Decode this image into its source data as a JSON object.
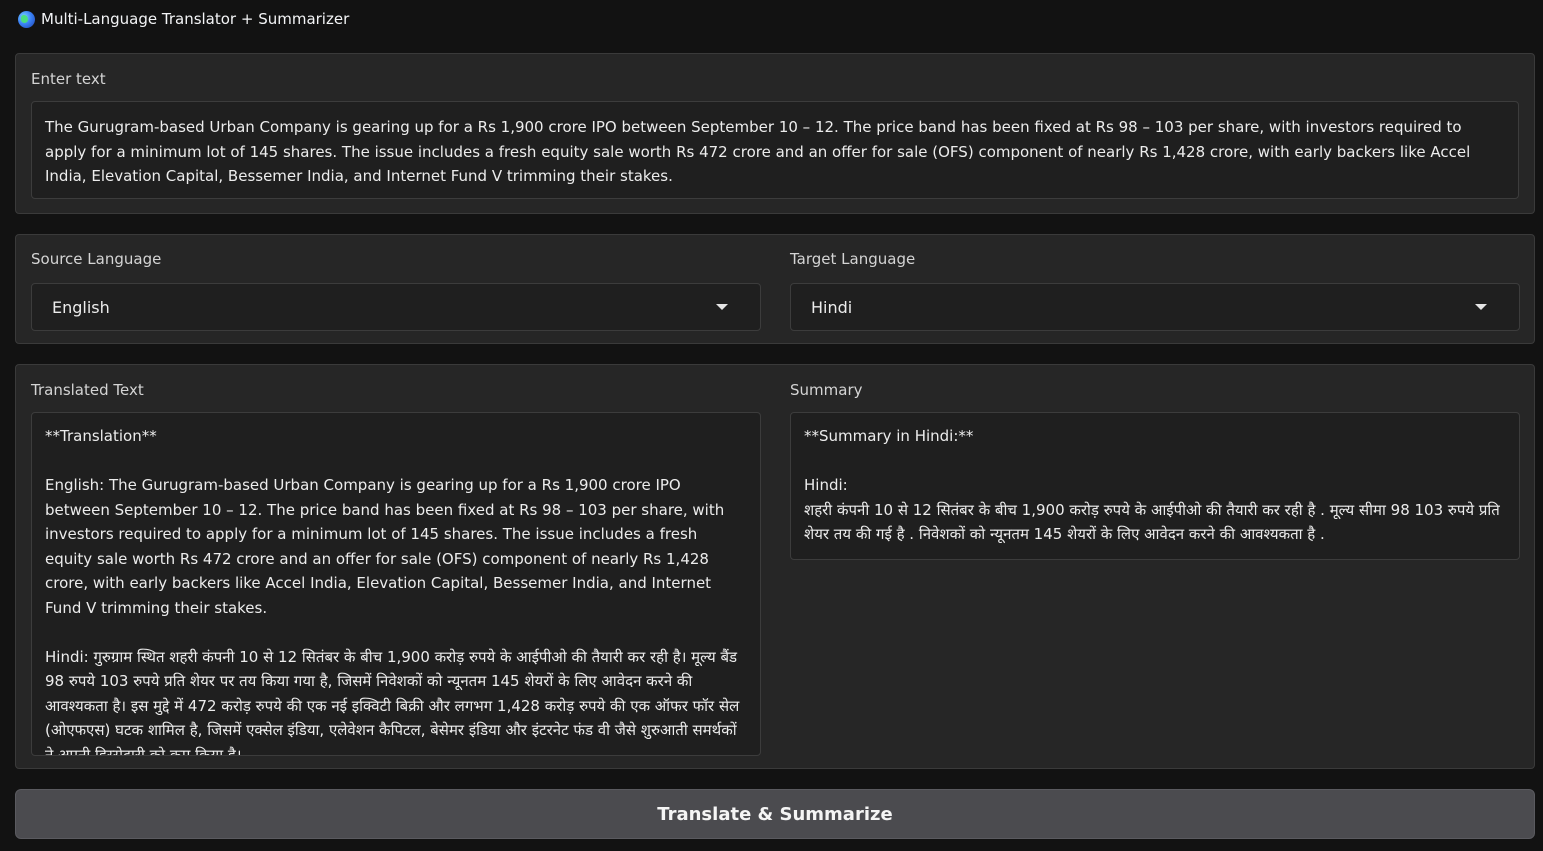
{
  "app": {
    "title": "Multi-Language Translator + Summarizer",
    "icon": "globe-icon"
  },
  "input": {
    "label": "Enter text",
    "value": "The Gurugram-based Urban Company is gearing up for a Rs 1,900 crore IPO between September 10 – 12. The price band has been fixed at Rs 98 – 103 per share, with investors required to apply for a minimum lot of 145 shares. The issue includes a fresh equity sale worth Rs 472 crore and an offer for sale (OFS) component of nearly Rs 1,428 crore, with early backers like Accel India, Elevation Capital, Bessemer India, and Internet Fund V trimming their stakes."
  },
  "languages": {
    "source": {
      "label": "Source Language",
      "value": "English"
    },
    "target": {
      "label": "Target Language",
      "value": "Hindi"
    }
  },
  "output": {
    "translated": {
      "label": "Translated Text",
      "value": "**Translation**\n\nEnglish: The Gurugram-based Urban Company is gearing up for a Rs 1,900 crore IPO between September 10 – 12. The price band has been fixed at Rs 98 – 103 per share, with investors required to apply for a minimum lot of 145 shares. The issue includes a fresh equity sale worth Rs 472 crore and an offer for sale (OFS) component of nearly Rs 1,428 crore, with early backers like Accel India, Elevation Capital, Bessemer India, and Internet Fund V trimming their stakes.\n\nHindi: गुरुग्राम स्थित शहरी कंपनी 10 से 12 सितंबर के बीच 1,900 करोड़ रुपये के आईपीओ की तैयारी कर रही है। मूल्य बैंड 98 रुपये 103 रुपये प्रति शेयर पर तय किया गया है, जिसमें निवेशकों को न्यूनतम 145 शेयरों के लिए आवेदन करने की आवश्यकता है। इस मुद्दे में 472 करोड़ रुपये की एक नई इक्विटी बिक्री और लगभग 1,428 करोड़ रुपये की एक ऑफर फॉर सेल (ओएफएस) घटक शामिल है, जिसमें एक्सेल इंडिया, एलेवेशन कैपिटल, बेसेमर इंडिया और इंटरनेट फंड वी जैसे शुरुआती समर्थकों ने अपनी हिस्सेदारी को कम किया है।"
    },
    "summary": {
      "label": "Summary",
      "value": "**Summary in Hindi:**\n\nHindi:\nशहरी कंपनी 10 से 12 सितंबर के बीच 1,900 करोड़ रुपये के आईपीओ की तैयारी कर रही है . मूल्य सीमा 98 103 रुपये प्रति शेयर तय की गई है . निवेशकों को न्यूनतम 145 शेयरों के लिए आवेदन करने की आवश्यकता है ."
    }
  },
  "actions": {
    "submit_label": "Translate & Summarize"
  }
}
